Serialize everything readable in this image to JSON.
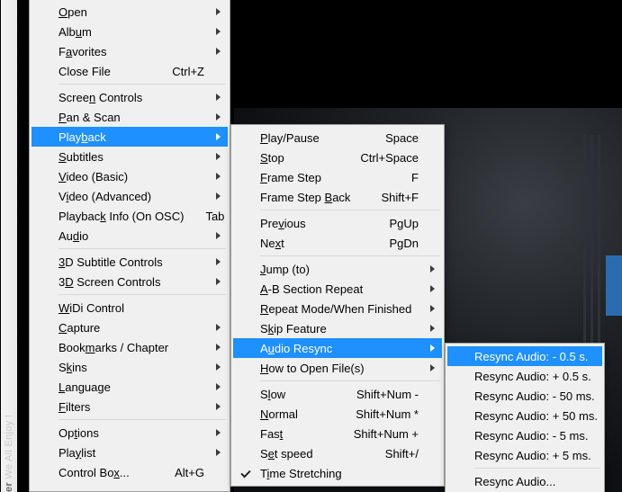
{
  "watermark": {
    "bold": "er",
    "rest": " We All Enjoy !"
  },
  "primary_menu": {
    "open_raw": "<span class='mn'>O</span>pen",
    "album_raw": "Alb<span class='mn'>u</span>m",
    "favorites_raw": "F<span class='mn'>a</span>vorites",
    "close_file": "Close File",
    "close_file_accel": "Ctrl+Z",
    "screen_controls_raw": "Scree<span class='mn'>n</span> Controls",
    "pan_scan_raw": "<span class='mn'>P</span>an & Scan",
    "playback_raw": "Play<span class='mn'>b</span>ack",
    "subtitles_raw": "<span class='mn'>S</span>ubtitles",
    "video_basic_raw": "<span class='mn'>V</span>ideo (Basic)",
    "video_adv_raw": "V<span class='mn'>i</span>deo (Advanced)",
    "playback_info_raw": "Playbac<span class='mn'>k</span> Info (On OSC)",
    "playback_info_accel": "Tab",
    "audio_raw": "Au<span class='mn'>d</span>io",
    "sub3d_raw": "<span class='mn'>3</span>D Subtitle Controls",
    "screen3d_raw": "3<span class='mn'>D</span> Screen Controls",
    "widi_raw": "<span class='mn'>W</span>iDi Control",
    "capture_raw": "<span class='mn'>C</span>apture",
    "bookmarks_raw": "Book<span class='mn'>m</span>arks / Chapter",
    "skins_raw": "S<span class='mn'>k</span>ins",
    "language_raw": "<span class='mn'>L</span>anguage",
    "filters_raw": "<span class='mn'>F</span>ilters",
    "options_raw": "Op<span class='mn'>t</span>ions",
    "playlist_raw": "Pla<span class='mn'>y</span>list",
    "control_box_raw": "Control Bo<span class='mn'>x</span>...",
    "control_box_accel": "Alt+G"
  },
  "playback_menu": {
    "play_pause_raw": "<span class='mn'>P</span>lay/Pause",
    "play_pause_accel": "Space",
    "stop_raw": "<span class='mn'>S</span>top",
    "stop_accel": "Ctrl+Space",
    "frame_step_raw": "<span class='mn'>F</span>rame Step",
    "frame_step_accel": "F",
    "frame_back_raw": "Frame Step <span class='mn'>B</span>ack",
    "frame_back_accel": "Shift+F",
    "previous_raw": "Pre<span class='mn'>v</span>ious",
    "previous_accel": "PgUp",
    "next_raw": "Ne<span class='mn'>x</span>t",
    "next_accel": "PgDn",
    "jump_raw": "<span class='mn'>J</span>ump (to)",
    "ab_raw": "<span class='mn'>A</span>-B Section Repeat",
    "repeat_raw": "<span class='mn'>R</span>epeat Mode/When Finished",
    "skip_raw": "S<span class='mn'>k</span>ip Feature",
    "audio_resync_raw": "A<span class='mn'>u</span>dio Resync",
    "howto_raw": "<span class='mn'>H</span>ow to Open File(s)",
    "slow_raw": "S<span class='mn'>l</span>ow",
    "slow_accel": "Shift+Num -",
    "normal_raw": "<span class='mn'>N</span>ormal",
    "normal_accel": "Shift+Num *",
    "fast_raw": "Fas<span class='mn'>t</span>",
    "fast_accel": "Shift+Num +",
    "setspeed_raw": "S<span class='mn'>e</span>t speed",
    "setspeed_accel": "Shift+/",
    "timestretch_raw": "T<span class='mn'>i</span>me Stretching"
  },
  "audio_resync_menu": {
    "m05s": "Resync Audio: - 0.5 s.",
    "p05s": "Resync Audio: + 0.5 s.",
    "m50ms": "Resync Audio: - 50 ms.",
    "p50ms": "Resync Audio: + 50 ms.",
    "m5ms": "Resync Audio: - 5 ms.",
    "p5ms": "Resync Audio: + 5 ms.",
    "custom": "Resync Audio..."
  }
}
